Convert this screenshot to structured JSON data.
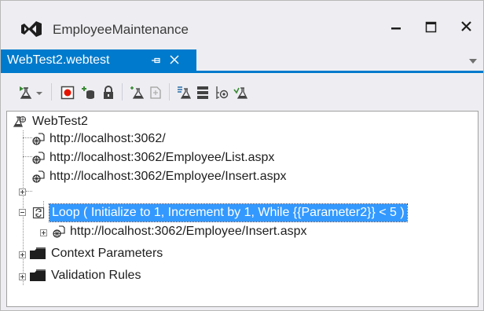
{
  "window": {
    "title": "EmployeeMaintenance",
    "accent_color": "#007acc",
    "selection_color": "#3399ff"
  },
  "tabs": [
    {
      "label": "WebTest2.webtest",
      "active": true
    }
  ],
  "toolbar": {
    "icons": [
      "run-test-icon",
      "dropdown-arrow-icon",
      "record-icon",
      "add-data-source-icon",
      "set-credentials-icon",
      "add-recorder-plugin-icon",
      "add-web-test-plugin-icon",
      "parameterize-servers-icon",
      "generate-code-icon",
      "create-loop-icon",
      "add-extraction-icon"
    ]
  },
  "tree": {
    "root": "WebTest2",
    "items": [
      {
        "label": "http://localhost:3062/",
        "icon": "web-request-icon"
      },
      {
        "label": "http://localhost:3062/Employee/List.aspx",
        "icon": "web-request-icon"
      },
      {
        "label": "http://localhost:3062/Employee/Insert.aspx",
        "icon": "web-request-icon",
        "expandable": true
      },
      {
        "label": "Loop ( Initialize to 1, Increment by 1, While {{Parameter2}} < 5 )",
        "icon": "loop-icon",
        "expanded": true,
        "selected": true
      },
      {
        "label": "http://localhost:3062/Employee/Insert.aspx",
        "icon": "web-request-icon",
        "expandable": true,
        "indent": 2
      },
      {
        "label": "Context Parameters",
        "icon": "folder-icon",
        "expandable": true
      },
      {
        "label": "Validation Rules",
        "icon": "folder-icon",
        "expandable": true
      }
    ]
  }
}
